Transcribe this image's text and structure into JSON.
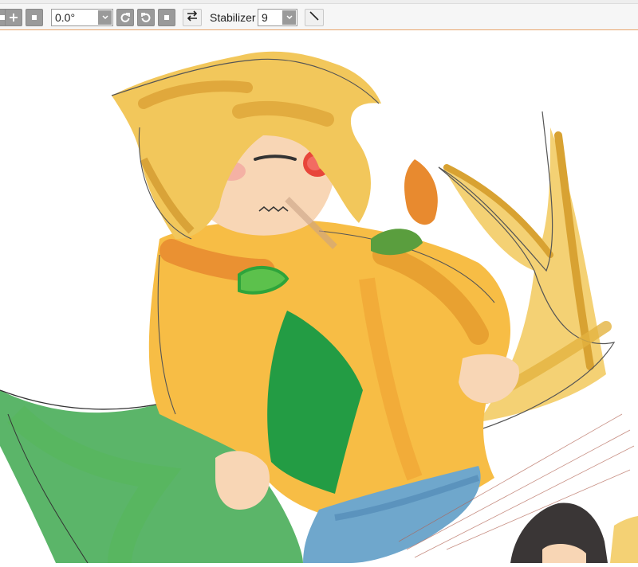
{
  "toolbar": {
    "rotation": {
      "value": "0.0°"
    },
    "stabilizer": {
      "label": "Stabilizer",
      "value": "9"
    },
    "icons": [
      "stop-icon",
      "zoom-in-icon",
      "stop-icon",
      "rotate-left-icon",
      "rotate-right-icon",
      "stop-icon",
      "flip-horizontal-icon",
      "line-tool-icon"
    ]
  },
  "colors": {
    "toolbar_bg": "#f6f6f6",
    "toolbar_border": "#e8a36a",
    "button_gray": "#9a9a9a",
    "hair": "#f2c75b",
    "shirt": "#f7bd45",
    "cloak": "#3ea84f",
    "skin": "#f8d6b5",
    "cheek": "#e8463a",
    "jeans": "#6fa7cc"
  }
}
